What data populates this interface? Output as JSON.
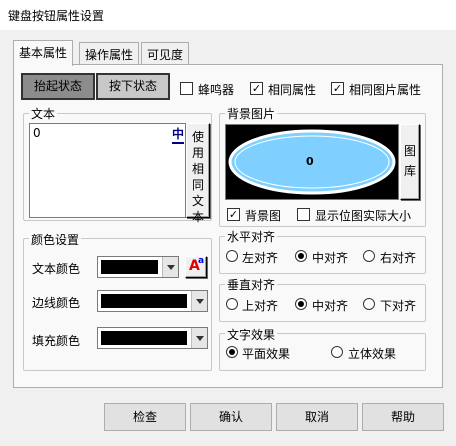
{
  "window": {
    "title": "键盘按钮属性设置"
  },
  "tabs": [
    {
      "label": "基本属性",
      "active": true
    },
    {
      "label": "操作属性",
      "active": false
    },
    {
      "label": "可见度",
      "active": false
    }
  ],
  "state_buttons": {
    "up": "抬起状态",
    "down": "按下状态",
    "selected": "up"
  },
  "top_checks": [
    {
      "label": "蜂鸣器",
      "checked": false
    },
    {
      "label": "相同属性",
      "checked": true
    },
    {
      "label": "相同图片属性",
      "checked": true
    }
  ],
  "text_group": {
    "title": "文本",
    "value": "0",
    "ime_glyph": "中",
    "use_same_text_button": "使用相同文本"
  },
  "bg_group": {
    "title": "背景图片",
    "preview_text": "0",
    "library_button": "图库",
    "bg_checkbox": {
      "label": "背景图",
      "checked": true
    },
    "actual_size_checkbox": {
      "label": "显示位图实际大小",
      "checked": false
    }
  },
  "color_group": {
    "title": "颜色设置",
    "rows": [
      {
        "label": "文本颜色",
        "color": "#000000"
      },
      {
        "label": "边线颜色",
        "color": "#000000"
      },
      {
        "label": "填充颜色",
        "color": "#000000"
      }
    ],
    "font_button_glyph": "A"
  },
  "h_align": {
    "title": "水平对齐",
    "options": [
      "左对齐",
      "中对齐",
      "右对齐"
    ],
    "selected": 1
  },
  "v_align": {
    "title": "垂直对齐",
    "options": [
      "上对齐",
      "中对齐",
      "下对齐"
    ],
    "selected": 1
  },
  "text_effect": {
    "title": "文字效果",
    "options": [
      "平面效果",
      "立体效果"
    ],
    "selected": 0
  },
  "footer": {
    "check": "检查",
    "ok": "确认",
    "cancel": "取消",
    "help": "帮助"
  },
  "colors": {
    "preview_fill": "#7fd0ff",
    "preview_bg": "#000000",
    "dialog_bg": "#f0f0f0",
    "panel_bg": "#f9f9f9"
  }
}
